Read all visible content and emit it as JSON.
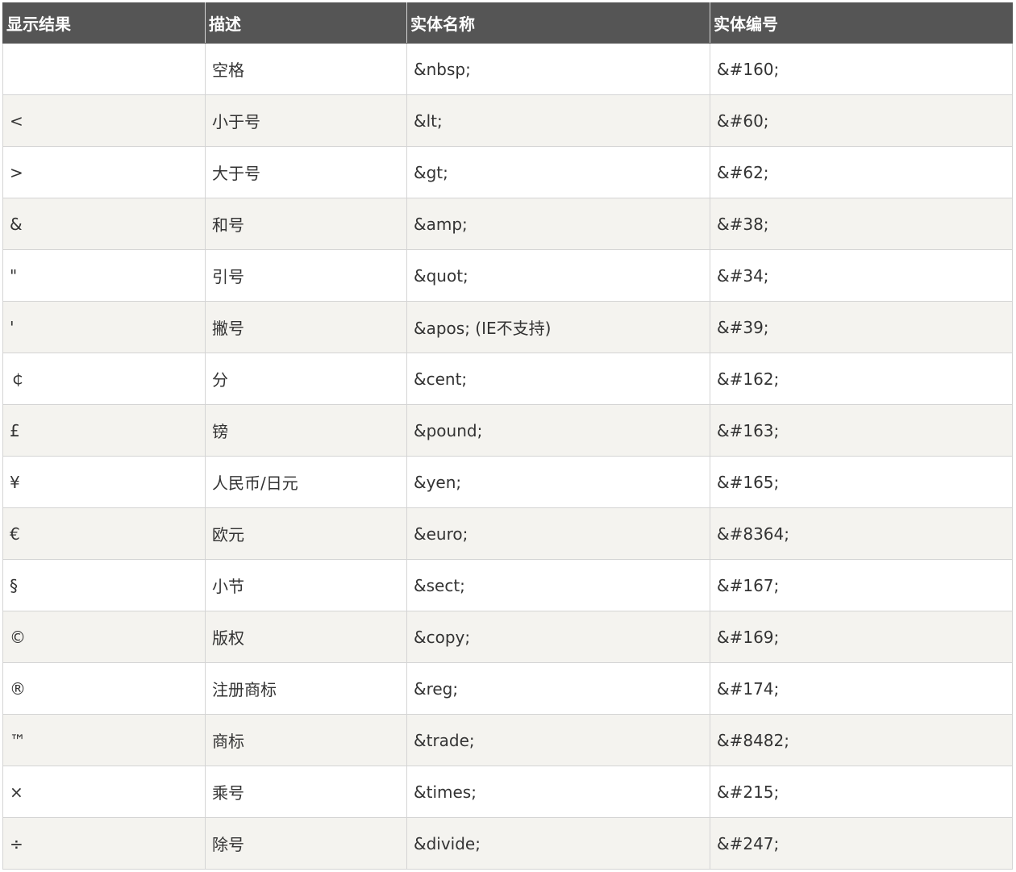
{
  "table": {
    "headers": [
      "显示结果",
      "描述",
      "实体名称",
      "实体编号"
    ],
    "rows": [
      [
        " ",
        "空格",
        "&nbsp;",
        "&#160;"
      ],
      [
        "<",
        "小于号",
        "&lt;",
        "&#60;"
      ],
      [
        ">",
        "大于号",
        "&gt;",
        "&#62;"
      ],
      [
        "&",
        "和号",
        "&amp;",
        "&#38;"
      ],
      [
        "\"",
        "引号",
        "&quot;",
        "&#34;"
      ],
      [
        "'",
        "撇号",
        "&apos; (IE不支持)",
        "&#39;"
      ],
      [
        "￠",
        "分",
        "&cent;",
        "&#162;"
      ],
      [
        "£",
        "镑",
        "&pound;",
        "&#163;"
      ],
      [
        "¥",
        "人民币/日元",
        "&yen;",
        "&#165;"
      ],
      [
        "€",
        "欧元",
        "&euro;",
        "&#8364;"
      ],
      [
        "§",
        "小节",
        "&sect;",
        "&#167;"
      ],
      [
        "©",
        "版权",
        "&copy;",
        "&#169;"
      ],
      [
        "®",
        "注册商标",
        "&reg;",
        "&#174;"
      ],
      [
        "™",
        "商标",
        "&trade;",
        "&#8482;"
      ],
      [
        "×",
        "乘号",
        "&times;",
        "&#215;"
      ],
      [
        "÷",
        "除号",
        "&divide;",
        "&#247;"
      ]
    ]
  },
  "colors": {
    "header_bg": "#555555",
    "header_text": "#ffffff",
    "row_alt_bg": "#f4f3ef",
    "border": "#d4d4d4"
  }
}
